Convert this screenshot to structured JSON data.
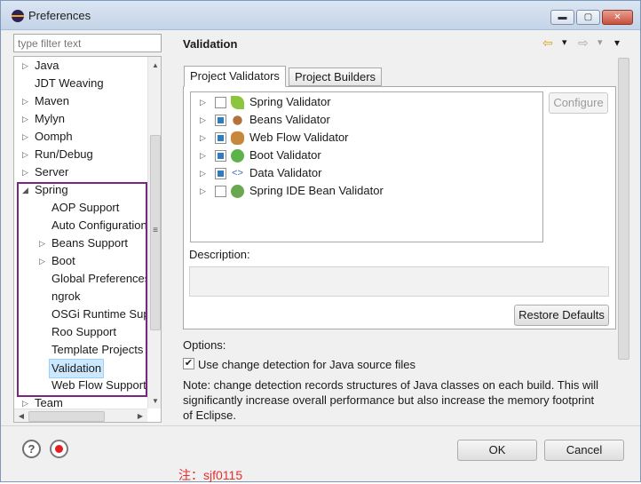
{
  "window": {
    "title": "Preferences",
    "buttons": {
      "minimize": "▬",
      "maximize": "▢",
      "close": "✕"
    }
  },
  "filter": {
    "placeholder": "type filter text"
  },
  "tree": [
    {
      "label": "Java",
      "expander": "▷"
    },
    {
      "label": "JDT Weaving",
      "expander": ""
    },
    {
      "label": "Maven",
      "expander": "▷"
    },
    {
      "label": "Mylyn",
      "expander": "▷"
    },
    {
      "label": "Oomph",
      "expander": "▷"
    },
    {
      "label": "Run/Debug",
      "expander": "▷"
    },
    {
      "label": "Server",
      "expander": "▷"
    },
    {
      "label": "Spring",
      "expander": "◢"
    },
    {
      "label": "AOP Support",
      "expander": ""
    },
    {
      "label": "Auto Configuration",
      "expander": ""
    },
    {
      "label": "Beans Support",
      "expander": "▷"
    },
    {
      "label": "Boot",
      "expander": "▷"
    },
    {
      "label": "Global Preferences",
      "expander": ""
    },
    {
      "label": "ngrok",
      "expander": ""
    },
    {
      "label": "OSGi Runtime Support",
      "expander": ""
    },
    {
      "label": "Roo Support",
      "expander": ""
    },
    {
      "label": "Template Projects",
      "expander": ""
    },
    {
      "label": "Validation",
      "expander": "",
      "selected": true
    },
    {
      "label": "Web Flow Support",
      "expander": ""
    },
    {
      "label": "Team",
      "expander": "▷"
    }
  ],
  "page": {
    "title": "Validation",
    "nav": {
      "back": "⇦",
      "back_drop": "▾",
      "forward": "⇨",
      "forward_drop": "▾",
      "menu": "▾"
    },
    "tabs": [
      {
        "label": "Project Validators"
      },
      {
        "label": "Project Builders"
      }
    ],
    "validators": [
      {
        "label": "Spring Validator",
        "checked": false,
        "icon": "spring-leaf-icon"
      },
      {
        "label": "Beans Validator",
        "checked": true,
        "icon": "bean-icon"
      },
      {
        "label": "Web Flow Validator",
        "checked": true,
        "icon": "webflow-icon"
      },
      {
        "label": "Boot Validator",
        "checked": true,
        "icon": "boot-power-icon"
      },
      {
        "label": "Data Validator",
        "checked": true,
        "icon": "data-brackets-icon"
      },
      {
        "label": "Spring IDE Bean Validator",
        "checked": false,
        "icon": "spring-ide-icon"
      }
    ],
    "expander": "▷",
    "configure_label": "Configure",
    "description_label": "Description:",
    "restore_label": "Restore Defaults",
    "options_label": "Options:",
    "change_detection": {
      "label": "Use change detection for Java source files",
      "checked": true,
      "mark": "✔"
    },
    "note": "Note: change detection records structures of Java classes on each build. This will significantly increase overall performance but also increase the memory footprint of Eclipse."
  },
  "footer": {
    "ok_label": "OK",
    "cancel_label": "Cancel",
    "help_glyph": "?"
  },
  "watermark": "注：sjf0115",
  "scroll_glyphs": {
    "up": "▲",
    "down": "▼",
    "left": "◀",
    "right": "▶",
    "grip": "≡"
  }
}
